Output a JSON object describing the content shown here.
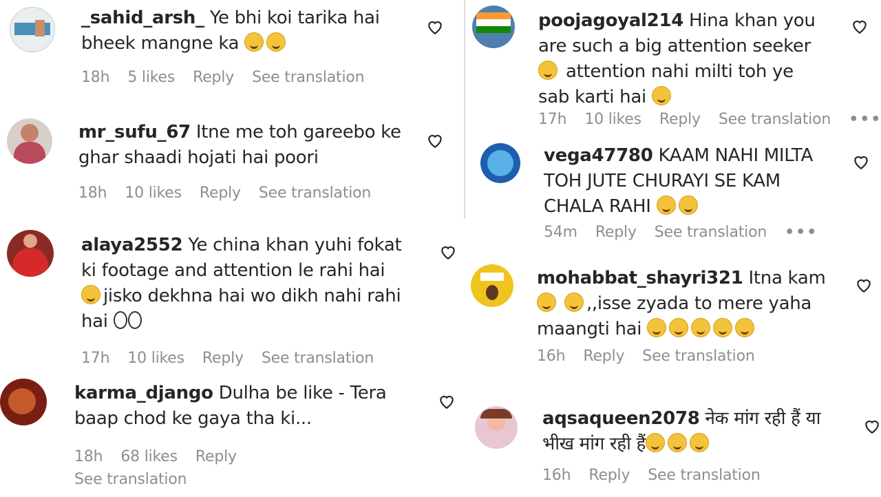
{
  "comments_left": [
    {
      "username": "_sahid_arsh_",
      "text": "Ye bhi koi tarika hai bheek mangne ka",
      "emoji_names": [
        "unamused-face-emoji",
        "rolling-eyes-emoji"
      ],
      "time": "18h",
      "likes": "5 likes",
      "reply": "Reply",
      "translate": "See translation"
    },
    {
      "username": "mr_sufu_67",
      "text": "Itne me toh gareebo ke ghar shaadi hojati hai poori",
      "emoji_names": [],
      "time": "18h",
      "likes": "10 likes",
      "reply": "Reply",
      "translate": "See translation"
    },
    {
      "username": "alaya2552",
      "text": "Ye china khan yuhi fokat ki footage and attention le rahi hai",
      "text2": "jisko dekhna hai wo dikh nahi rahi hai",
      "emoji_names": [
        "rofl-emoji",
        "eyes-emoji"
      ],
      "time": "17h",
      "likes": "10 likes",
      "reply": "Reply",
      "translate": "See translation"
    },
    {
      "username": "karma_django",
      "text": "Dulha be like - Tera baap chod ke gaya tha ki...",
      "emoji_names": [],
      "time": "18h",
      "likes": "68 likes",
      "reply": "Reply",
      "translate": "See translation"
    }
  ],
  "comments_right": [
    {
      "username": "poojagoyal214",
      "text": "Hina khan you are such a big attention seeker",
      "text2": "attention nahi milti toh ye sab karti hai",
      "emoji_names": [
        "grinning-face-emoji",
        "grinning-face-emoji"
      ],
      "time": "17h",
      "likes": "10 likes",
      "reply": "Reply",
      "translate": "See translation",
      "more": "•••"
    },
    {
      "username": "vega47780",
      "text": "KAAM NAHI MILTA TOH JUTE CHURAYI SE KAM CHALA RAHI",
      "emoji_names": [
        "grinning-face-emoji",
        "grinning-face-emoji"
      ],
      "time": "54m",
      "reply": "Reply",
      "translate": "See translation",
      "more": "•••"
    },
    {
      "username": "mohabbat_shayri321",
      "text": "Itna kam",
      "text2": ",,isse zyada to mere yaha maangti hai",
      "emoji_names": [
        "sad-face-emoji",
        "sad-face-emoji",
        "rofl-emoji",
        "rofl-emoji",
        "rofl-emoji",
        "rofl-emoji",
        "rofl-emoji"
      ],
      "time": "16h",
      "reply": "Reply",
      "translate": "See translation"
    },
    {
      "username": "aqsaqueen2078",
      "text": "नेक मांग रही हैं या भीख मांग रही हैं",
      "emoji_names": [
        "grinning-face-emoji",
        "grinning-face-emoji",
        "grinning-face-emoji"
      ],
      "time": "16h",
      "reply": "Reply",
      "translate": "See translation"
    }
  ],
  "colors": {
    "text": "#262626",
    "meta": "#8e8e8e",
    "divider": "#dbdbdb",
    "emoji": "#f3c43b"
  }
}
